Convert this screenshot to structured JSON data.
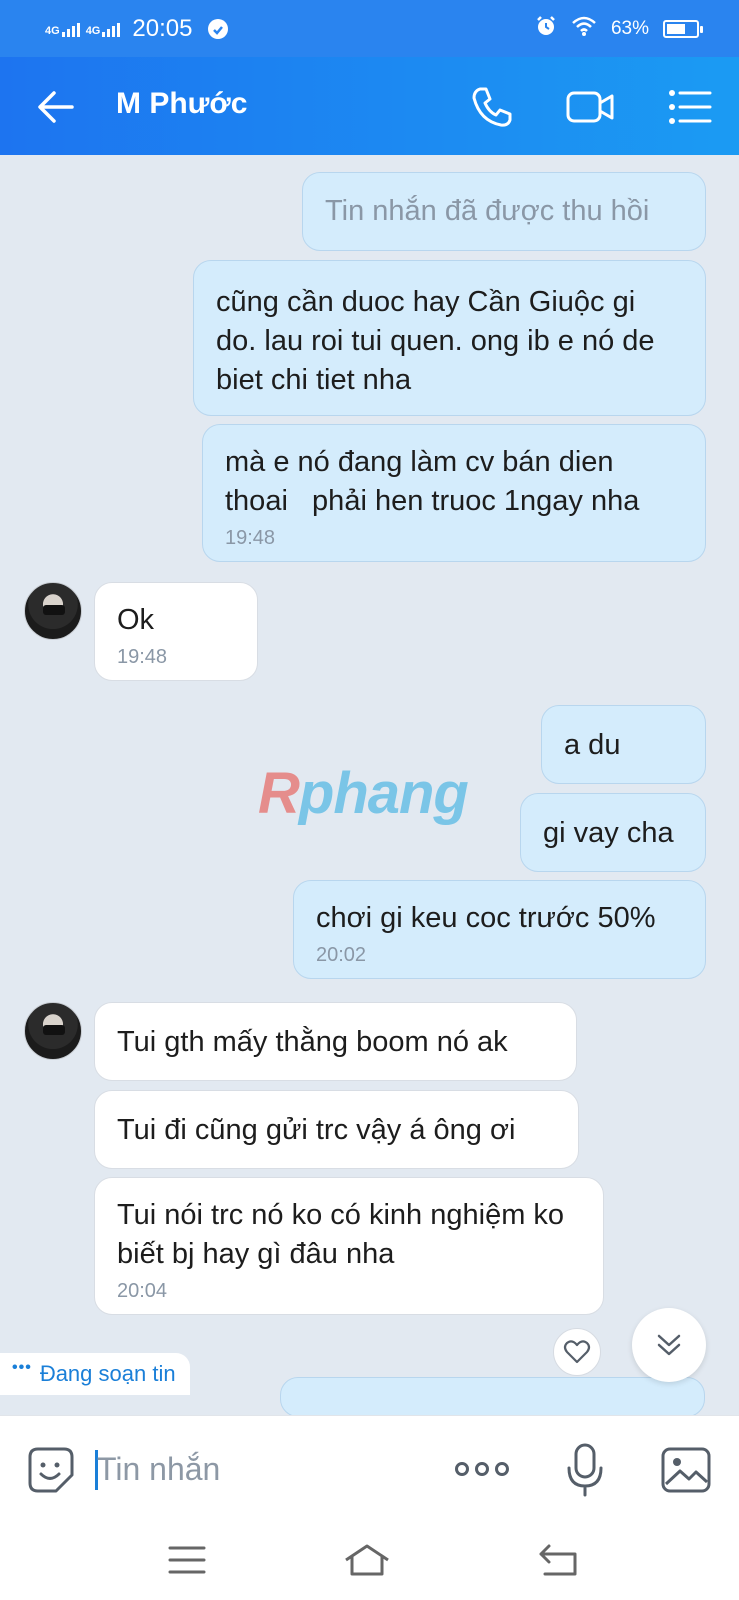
{
  "status_bar": {
    "network_1": "4G",
    "network_2": "4G",
    "time": "20:05",
    "battery": "63%",
    "battery_level": 0.63
  },
  "header": {
    "contact_name": "M Phước"
  },
  "messages": [
    {
      "side": "me",
      "text": "Tin nhắn đã được thu hồi",
      "recalled": true
    },
    {
      "side": "me",
      "text": "cũng cần duoc hay Cần Giuộc gi do. lau roi tui quen. ong ib e nó de biet chi tiet nha"
    },
    {
      "side": "me",
      "text": "mà e nó đang làm cv bán dien thoai   phải hen truoc 1ngay nha",
      "time": "19:48"
    },
    {
      "side": "them",
      "text": "Ok",
      "time": "19:48"
    },
    {
      "side": "me",
      "text": "a du"
    },
    {
      "side": "me",
      "text": "gi vay cha"
    },
    {
      "side": "me",
      "text": "chơi gi keu coc trước 50%",
      "time": "20:02"
    },
    {
      "side": "them",
      "text": "Tui gth mấy thằng boom nó ak"
    },
    {
      "side": "them",
      "text": "Tui đi cũng gửi trc vậy á ông ơi"
    },
    {
      "side": "them",
      "text": "Tui nói trc nó ko có kinh nghiệm ko biết bj hay gì đâu nha",
      "time": "20:04"
    }
  ],
  "watermark": {
    "first": "R",
    "rest": "phang"
  },
  "typing_indicator": "Đang soạn tin",
  "input": {
    "placeholder": "Tin nhắn",
    "value": ""
  },
  "icons": {
    "back": "arrow-left-icon",
    "call": "phone-icon",
    "video": "video-camera-icon",
    "menu": "list-menu-icon",
    "emoji": "sticker-emoji-icon",
    "more": "more-dots-icon",
    "mic": "microphone-icon",
    "image": "image-gallery-icon",
    "heart": "heart-react-icon",
    "scroll": "double-chevron-down-icon"
  },
  "colors": {
    "header": "#1d74f0",
    "my_bubble": "#d4ecfc",
    "their_bubble": "#ffffff",
    "background": "#e2e9f1",
    "accent": "#1a7fd8"
  }
}
